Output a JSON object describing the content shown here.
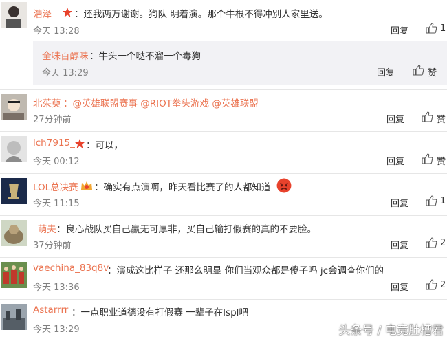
{
  "comments": [
    {
      "name": "浩泽_",
      "text": "：还我两万谢谢。狗队 明着演。那个牛根不得冲别人家里送。",
      "time": "今天 13:28",
      "reply": "回复",
      "likes": "1"
    },
    {
      "name": "全味百醇味",
      "text": "：牛头一个哒不溜一个毒狗",
      "time": "今天 13:29",
      "reply": "回复",
      "likes": "赞"
    },
    {
      "name": "北茱萸",
      "text": "：@英雄联盟赛事 @RIOT拳头游戏 @英雄联盟",
      "time": "27分钟前",
      "reply": "回复",
      "likes": "赞"
    },
    {
      "name": "lch7915_",
      "text": "：可以，",
      "time": "今天 00:12",
      "reply": "回复",
      "likes": "赞"
    },
    {
      "name": "LOL总决赛",
      "text": "：确实有点演啊，昨天看比赛了的人都知道",
      "time": "今天 11:15",
      "reply": "回复",
      "likes": "1"
    },
    {
      "name": "_萌夫",
      "text": "：良心战队买自己赢无可厚非，买自己输打假赛的真的不要脸。",
      "time": "37分钟前",
      "reply": "回复",
      "likes": "2"
    },
    {
      "name": "vaechina_83q8v",
      "text": "：演成这比样子 还那么明显 你们当观众都是傻子吗   jc会调查你们的",
      "time": "今天 13:36",
      "reply": "回复",
      "likes": "2"
    },
    {
      "name": "Astarrrr",
      "text": "：一点职业道德没有打假赛 一辈子在lspl吧",
      "time": "今天 13:29",
      "reply": "",
      "likes": ""
    }
  ],
  "watermark": "头条号 / 电竞肚槽君",
  "colors": {
    "name": "#eb7350",
    "sub_bg": "#f2f2f5"
  }
}
